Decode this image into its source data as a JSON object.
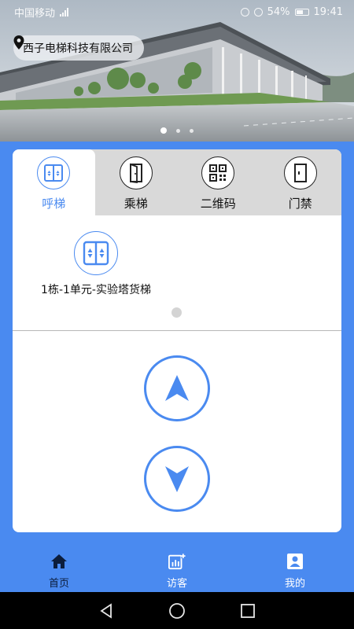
{
  "status_bar": {
    "carrier": "中国移动",
    "battery_text": "54%",
    "time": "19:41"
  },
  "banner": {
    "company_name": "西子电梯科技有限公司",
    "slide_count": 3,
    "active_slide": 1
  },
  "tabs": [
    {
      "label": "呼梯",
      "icon": "elevator-doors-icon",
      "active": true
    },
    {
      "label": "乘梯",
      "icon": "door-enter-icon",
      "active": false
    },
    {
      "label": "二维码",
      "icon": "qr-code-icon",
      "active": false
    },
    {
      "label": "门禁",
      "icon": "access-door-icon",
      "active": false
    }
  ],
  "elevator": {
    "label": "1栋-1单元-实验塔货梯",
    "icon": "elevator-doors-icon"
  },
  "call_buttons": {
    "up_icon": "arrow-up-icon",
    "down_icon": "arrow-down-icon"
  },
  "bottom_nav": [
    {
      "label": "首页",
      "icon": "home-icon",
      "active": true
    },
    {
      "label": "访客",
      "icon": "visitor-add-icon",
      "active": false
    },
    {
      "label": "我的",
      "icon": "profile-icon",
      "active": false
    }
  ],
  "colors": {
    "accent": "#4a8af0",
    "tab_bar_bg": "#d9d9d9",
    "nav_active_text": "#0c1d3c"
  }
}
